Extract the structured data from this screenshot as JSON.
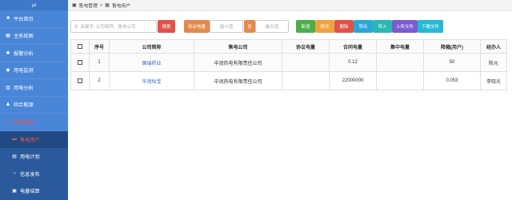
{
  "sidebar": {
    "toggle_icon": "⇄",
    "items": [
      {
        "label": "平台首页",
        "icon": "home-icon",
        "glyph": "■"
      },
      {
        "label": "主系统图",
        "icon": "diagram-icon",
        "glyph": "▦"
      },
      {
        "label": "报警分析",
        "icon": "bell-icon",
        "glyph": "✱"
      },
      {
        "label": "用电监测",
        "icon": "eye-icon",
        "glyph": "◉"
      },
      {
        "label": "用电分析",
        "icon": "chart-icon",
        "glyph": "▥"
      },
      {
        "label": "综合能源",
        "icon": "user-icon",
        "glyph": "♟"
      },
      {
        "label": "售电管理",
        "icon": "folder-icon",
        "glyph": "▸"
      }
    ],
    "sub_items": [
      {
        "label": "售电用户",
        "icon": "users-icon",
        "glyph": "▬"
      },
      {
        "label": "用电计划",
        "icon": "document-icon",
        "glyph": "▤"
      },
      {
        "label": "信息发布",
        "icon": "circle-icon",
        "glyph": "○"
      },
      {
        "label": "电量结算",
        "icon": "receipt-icon",
        "glyph": "▣"
      }
    ]
  },
  "breadcrumb": {
    "parent": "售电管理",
    "separator": ">",
    "current": "售电用户",
    "glyph": "▣",
    "current_glyph": "▦"
  },
  "toolbar": {
    "search_placeholder": "关键字: 公司简称、售电公司",
    "search_button": "搜索",
    "range_label": "协议电量",
    "min_placeholder": "最小值",
    "to_label": "至",
    "max_placeholder": "最大值",
    "buttons": {
      "add": "新增",
      "edit": "修改",
      "delete": "删除",
      "export": "导出",
      "import": "导入",
      "upload": "上传文件",
      "download": "下载文件"
    }
  },
  "colors": {
    "sidebar_bg": "#4a86d8",
    "active_red": "#e25a4a",
    "add": "#4cae4c",
    "edit": "#f0a23b",
    "delete": "#e0524a",
    "export": "#2aa8d8",
    "import": "#2bb8b0",
    "upload": "#7a5bd0",
    "download": "#26b9d6"
  },
  "table": {
    "headers": [
      "序号",
      "公司简称",
      "售电公司",
      "协议电量",
      "合同电量",
      "集中电量",
      "降幅(用户)",
      "经办人"
    ],
    "rows": [
      {
        "no": "1",
        "company": "国瑞药业",
        "seller": "中润热电有限责任公司",
        "agreed": "",
        "contract": "0.12",
        "centralized": "",
        "decline": "50",
        "handler": "陈元"
      },
      {
        "no": "2",
        "company": "华润怡宝",
        "seller": "中润热电有限责任公司",
        "agreed": "",
        "contract": "22000000",
        "centralized": "",
        "decline": "0.053",
        "handler": "李晓光"
      }
    ]
  }
}
